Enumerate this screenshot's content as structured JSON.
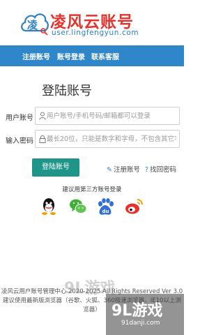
{
  "header": {
    "logo_char": "凌",
    "site_title": "凌风云账号",
    "site_url": "user.lingfengyun.com"
  },
  "nav": {
    "items": [
      {
        "label": "注册账号"
      },
      {
        "label": "账号登录"
      },
      {
        "label": "联系客服"
      }
    ]
  },
  "login": {
    "title": "登陆账号",
    "username_label": "用户账号",
    "username_placeholder": "用户账号/手机号码/邮箱都可以登录",
    "password_label": "输入密码",
    "password_placeholder": "最长20位，只能是数字和字母，不包含其它字",
    "submit_label": "登陆账号",
    "register_link": "注册账号",
    "recover_link": "找回密码"
  },
  "third_party": {
    "title": "建议用第三方账号登录",
    "providers": [
      {
        "icon": "qq-icon"
      },
      {
        "icon": "wechat-icon"
      },
      {
        "icon": "baidu-icon"
      },
      {
        "icon": "weibo-icon"
      }
    ]
  },
  "footer": {
    "copyright": "凌风云用户账号管理中心 2020-2025 All Rights Reserved Ver 3.0",
    "browser_tip": "建议使用最新版浏览器（谷歌、火狐、360极速浏览器、IE10以上浏览器）"
  },
  "watermark": {
    "brand": "9L游戏",
    "url": "91danji.com"
  },
  "colors": {
    "brand_red": "#e6322d",
    "nav_blue": "#2f86c8",
    "button_teal": "#1f9488"
  }
}
